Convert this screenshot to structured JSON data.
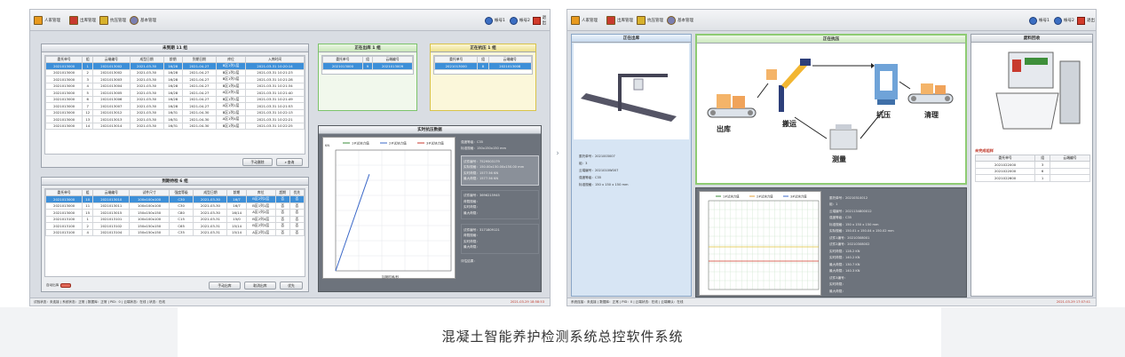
{
  "caption": "混凝土智能养护检测系统总控软件系统",
  "toolbar": {
    "btn1": "人家管理",
    "btn2": "出库管理",
    "btn3": "抗压管理",
    "btn4": "基本管理",
    "right1": "帐号1",
    "right2": "帐号2",
    "exit": "退出"
  },
  "left": {
    "inventory": {
      "title": "未到期 11 组",
      "columns": [
        "委托单号",
        "组",
        "云端编号",
        "成型日期",
        "龄期",
        "到期日期",
        "库位",
        "入库时间"
      ],
      "rows": [
        [
          "2021013000",
          "1",
          "2021013002",
          "2021-03-30",
          "16/28",
          "2021-04-27",
          "B区1列1层",
          "2021-03-31 10:20:14"
        ],
        [
          "2021013000",
          "2",
          "2021013002",
          "2021-03-30",
          "16/28",
          "2021-04-27",
          "B区1列2层",
          "2021-03-31 10:21:23"
        ],
        [
          "2021013000",
          "3",
          "2021013003",
          "2021-03-30",
          "16/28",
          "2021-04-27",
          "B区1列3层",
          "2021-03-31 10:21:28"
        ],
        [
          "2021013000",
          "4",
          "2021013004",
          "2021-03-30",
          "16/28",
          "2021-04-27",
          "B区1列4层",
          "2021-03-31 10:21:34"
        ],
        [
          "2021013000",
          "5",
          "2021013005",
          "2021-03-30",
          "16/28",
          "2021-04-27",
          "A区2列1层",
          "2021-03-31 10:21:40"
        ],
        [
          "2021013000",
          "6",
          "2021013006",
          "2021-03-30",
          "16/28",
          "2021-04-27",
          "B区1列1层",
          "2021-03-31 10:21:49"
        ],
        [
          "2021013000",
          "7",
          "2021013007",
          "2021-03-30",
          "16/28",
          "2021-04-27",
          "A区1列1层",
          "2021-03-31 10:21:53"
        ],
        [
          "2021013000",
          "12",
          "2021013012",
          "2021-03-30",
          "16/31",
          "2021-04-30",
          "B区1列2层",
          "2021-03-31 10:22:13"
        ],
        [
          "2021013000",
          "13",
          "2021013013",
          "2021-03-30",
          "16/31",
          "2021-04-30",
          "A区1列4层",
          "2021-03-31 10:22:21"
        ],
        [
          "2021013000",
          "14",
          "2021013014",
          "2021-03-30",
          "16/31",
          "2021-04-30",
          "B区1列4层",
          "2021-03-31 10:22:25"
        ]
      ],
      "manual_btn": "手动删除",
      "query_btn": "查询"
    },
    "outbound": {
      "title": "正在出库 1 组",
      "columns": [
        "委托单号",
        "组",
        "云端编号"
      ],
      "row": [
        "2021013000",
        "9",
        "2021013009"
      ]
    },
    "pressing": {
      "title": "正在抗压 1 组",
      "columns": [
        "委托单号",
        "组",
        "云端编号"
      ],
      "row": [
        "2021013000",
        "8",
        "2021013008"
      ]
    },
    "expired": {
      "title": "到期待检 6 组",
      "columns": [
        "委托单号",
        "组",
        "云端编号",
        "试件尺寸",
        "强度等级",
        "成型日期",
        "龄期",
        "库位",
        "超期",
        "优先"
      ],
      "rows": [
        [
          "2021013000",
          "10",
          "2021013010",
          "100x100x100",
          "C30",
          "2021-03-30",
          "16/7",
          "B区2列2层",
          "否",
          "否"
        ],
        [
          "2021013000",
          "11",
          "2021013011",
          "100x100x100",
          "C30",
          "2021-03-30",
          "16/7",
          "B区1列1层",
          "否",
          "否"
        ],
        [
          "2021013000",
          "15",
          "2021013015",
          "150x150x150",
          "C80",
          "2021-03-30",
          "16/14",
          "A区1列2层",
          "否",
          "否"
        ],
        [
          "2021013100",
          "1",
          "2021013101",
          "100x100x100",
          "C15",
          "2021-03-31",
          "15/0",
          "B区2列4层",
          "否",
          "否"
        ],
        [
          "2021013100",
          "2",
          "2021013102",
          "150x150x150",
          "C65",
          "2021-03-31",
          "15/14",
          "B区2列3层",
          "否",
          "否"
        ],
        [
          "2021013100",
          "4",
          "2021013104",
          "150x150x150",
          "C35",
          "2021-03-31",
          "15/14",
          "A区2列1层",
          "否",
          "否"
        ]
      ],
      "auto_label": "自动出库",
      "btn_manual_out": "手动出库",
      "btn_cancel": "取消出库",
      "btn_priority": "优先"
    },
    "press_data": {
      "title": "实时抗压数据",
      "legend": [
        "1#试块力值",
        "2#试块力值",
        "3#试块力值"
      ],
      "ylabel": "KN",
      "xlabel": "加荷时间/秒",
      "info1": "强度等级：C35",
      "info2": "标准规格：150x150x150 mm",
      "s1": [
        "试件编号：7529503179",
        "实际规格：150.00x150.00x150.00 mm",
        "实时荷载：1577.56 KN",
        "最大荷载：1577.56 KN"
      ],
      "s2": [
        "试件编号：3696215945",
        "荷载规格：",
        "实时荷载：",
        "最大荷载："
      ],
      "s3": [
        "试件编号：3171809121",
        "荷载规格：",
        "实时荷载：",
        "最大荷载："
      ],
      "result": "评估结果：",
      "chart_data": {
        "type": "line",
        "series": [
          {
            "name": "1#试块力值",
            "x": [
              0,
              35
            ],
            "y": [
              0,
              1600
            ]
          }
        ],
        "xlim": [
          0,
          120
        ],
        "ylim": [
          0,
          2000
        ]
      }
    },
    "status": "试验状态：未连接 | 系统状态：正常 | 数据库：正常 | PID：0 | 云端状态：在线 | 状态：在线",
    "timestamp": "2021-03-29 18:58:53"
  },
  "right": {
    "outbound_title": "正在出库",
    "out_info": [
      "委托单号：2021003007",
      "组：3",
      "云端编号：2021010W007",
      "强度等级：C35",
      "标准规格：150 x 150 x 150 mm"
    ],
    "process_title": "正在抗压",
    "stages": [
      "出库",
      "搬运",
      "测量",
      "抗压",
      "清理"
    ],
    "material_title": "废料回收",
    "unfinished_title": "未完成组样",
    "unfinished_cols": [
      "委托单号",
      "组",
      "云端编号"
    ],
    "unfinished_rows": [
      [
        "2021022000",
        "3",
        ""
      ],
      [
        "2021022000",
        "6",
        ""
      ],
      [
        "2021022600",
        "1",
        ""
      ]
    ],
    "press_legend": [
      "1#试块力值",
      "2#试块力值",
      "3#试块力值"
    ],
    "press_info": [
      "委托单号：20210310012",
      "组：1",
      "云端编号：2021134800012",
      "强度等级：C35",
      "标准规格：150 x 150 x 150 mm",
      "实际规格：150.01 x 150.04 x 150.02 mm",
      "试件1编号：20210308001",
      "试件2编号：20210308002",
      "实时荷载：128.2 KN",
      "实时荷载：140.2 KN",
      "最大荷载：130.7 KN",
      "最大荷载：140.3 KN",
      "试件3编号：",
      "实时荷载：",
      "最大荷载："
    ],
    "status": "系统连接：未连接 | 数据库：正常 | PID：0 | 云端状态：在线 | 云端确认：在线",
    "timestamp": "2021-03-29 17:07:41"
  }
}
